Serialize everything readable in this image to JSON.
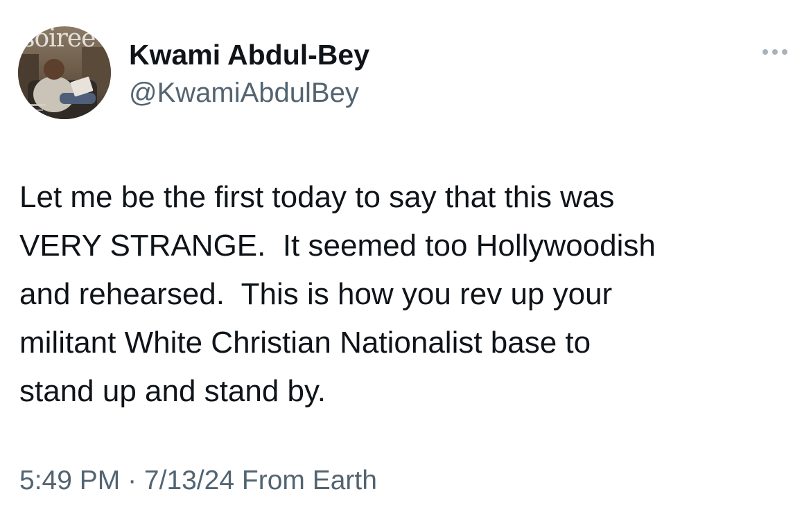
{
  "tweet": {
    "avatar_label": "soiree",
    "author": {
      "display_name": "Kwami Abdul-Bey",
      "handle": "@KwamiAbdulBey"
    },
    "more_icon": "more-horizontal-icon",
    "body_lines": [
      "Let me be the first today to say that this was",
      "VERY STRANGE.  It seemed too Hollywoodish",
      "and rehearsed.  This is how you rev up your",
      "militant White Christian Nationalist base to",
      "stand up and stand by."
    ],
    "meta": {
      "time": "5:49 PM",
      "separator": " · ",
      "date": "7/13/24",
      "source": " From Earth"
    }
  },
  "colors": {
    "text_primary": "#0f1419",
    "text_secondary": "#536471",
    "background": "#ffffff"
  }
}
